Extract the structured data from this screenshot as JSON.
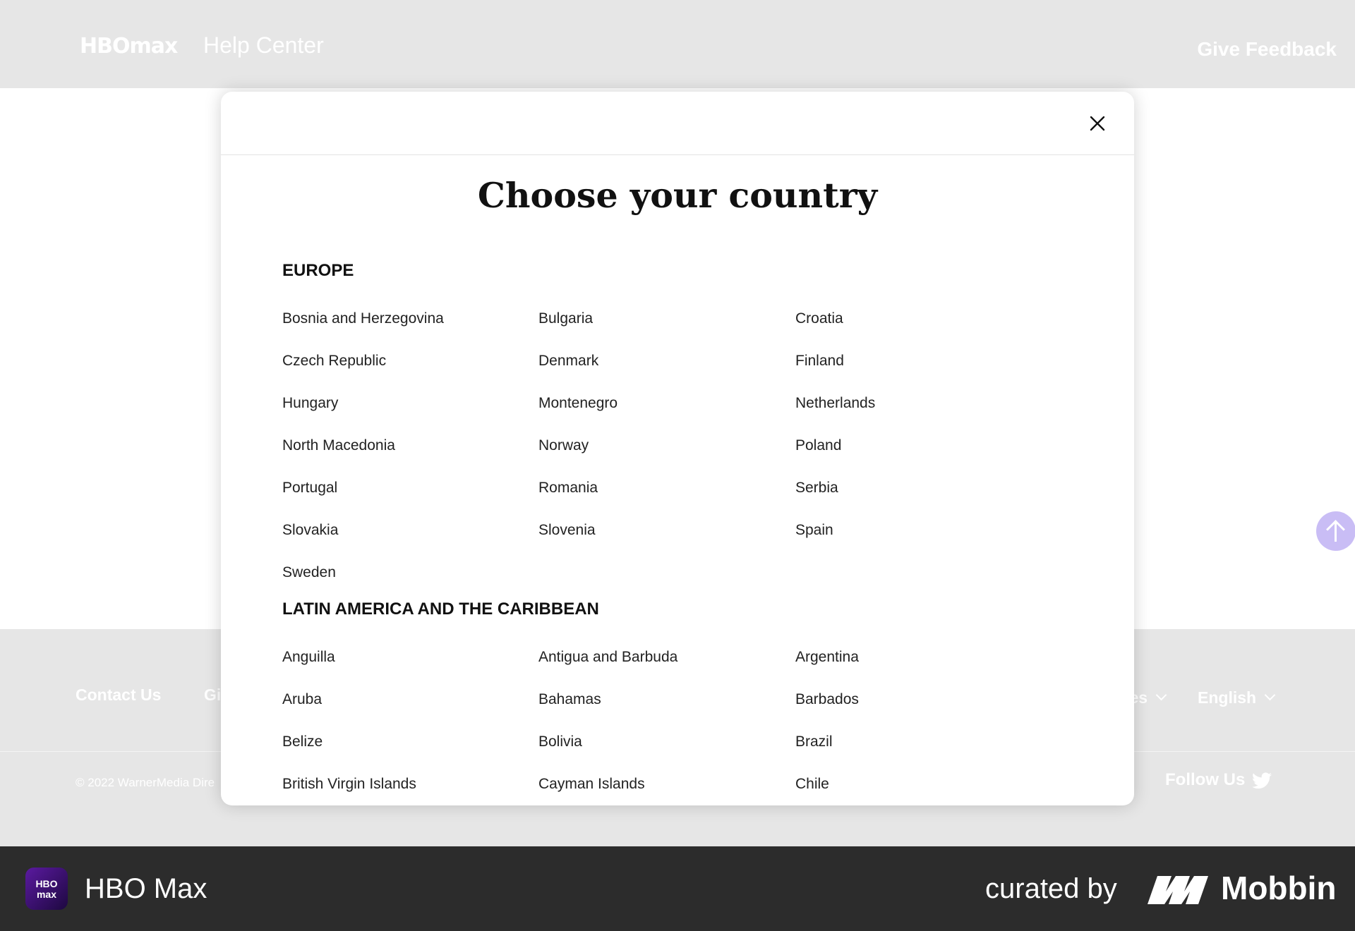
{
  "header": {
    "logo_text": "HBOmax",
    "section_title": "Help Center",
    "feedback_label": "Give Feedback"
  },
  "footer": {
    "contact_label": "Contact Us",
    "give_label": "Gi",
    "country_label": "ates",
    "language_label": "English",
    "copyright": "© 2022 WarnerMedia Dire",
    "follow_label": "Follow Us"
  },
  "modal": {
    "title": "Choose your country",
    "regions": [
      {
        "name": "EUROPE",
        "countries": [
          "Bosnia and Herzegovina",
          "Bulgaria",
          "Croatia",
          "Czech Republic",
          "Denmark",
          "Finland",
          "Hungary",
          "Montenegro",
          "Netherlands",
          "North Macedonia",
          "Norway",
          "Poland",
          "Portugal",
          "Romania",
          "Serbia",
          "Slovakia",
          "Slovenia",
          "Spain",
          "Sweden"
        ]
      },
      {
        "name": "LATIN AMERICA AND THE CARIBBEAN",
        "countries": [
          "Anguilla",
          "Antigua and Barbuda",
          "Argentina",
          "Aruba",
          "Bahamas",
          "Barbados",
          "Belize",
          "Bolivia",
          "Brazil",
          "British Virgin Islands",
          "Cayman Islands",
          "Chile"
        ]
      }
    ]
  },
  "brand_bar": {
    "app_icon_text": "HBO max",
    "app_name": "HBO Max",
    "curated_label": "curated by",
    "brand_name": "Mobbin"
  },
  "icons": {
    "close": "close-icon",
    "scroll_top": "arrow-up-icon",
    "twitter": "twitter-icon"
  },
  "colors": {
    "accent": "#c9bdf5",
    "header_bg": "#e6e6e6",
    "brand_bar_bg": "#2c2c2c"
  }
}
